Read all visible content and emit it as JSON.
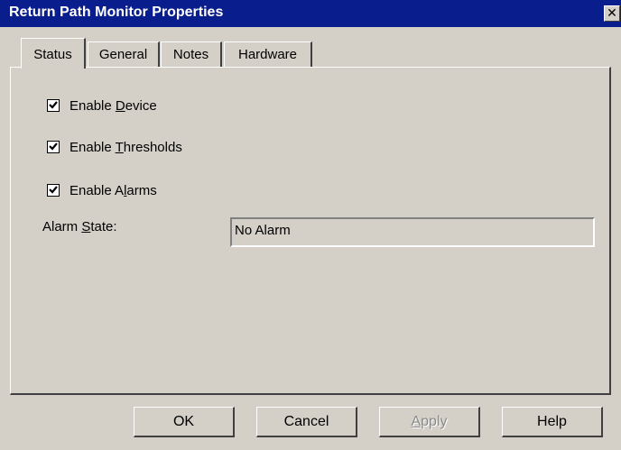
{
  "window": {
    "title": "Return Path Monitor Properties",
    "close_glyph": "✕"
  },
  "tabs": [
    {
      "label": "Status",
      "active": true
    },
    {
      "label": "General",
      "active": false
    },
    {
      "label": "Notes",
      "active": false
    },
    {
      "label": "Hardware",
      "active": false
    }
  ],
  "status": {
    "enable_device": {
      "pre": "Enable ",
      "mnemonic": "D",
      "post": "evice",
      "checked": true
    },
    "enable_thresholds": {
      "pre": "Enable ",
      "mnemonic": "T",
      "post": "hresholds",
      "checked": true
    },
    "enable_alarms": {
      "pre": "Enable A",
      "mnemonic": "l",
      "post": "arms",
      "checked": true
    },
    "alarm_state": {
      "label_pre": "Alarm ",
      "label_mnemonic": "S",
      "label_post": "tate:",
      "value": "No Alarm"
    }
  },
  "buttons": {
    "ok": "OK",
    "cancel": "Cancel",
    "apply_mnemonic": "A",
    "apply_post": "pply",
    "help": "Help"
  },
  "colors": {
    "titlebar": "#0a1d8c",
    "face": "#d4d0c8"
  }
}
